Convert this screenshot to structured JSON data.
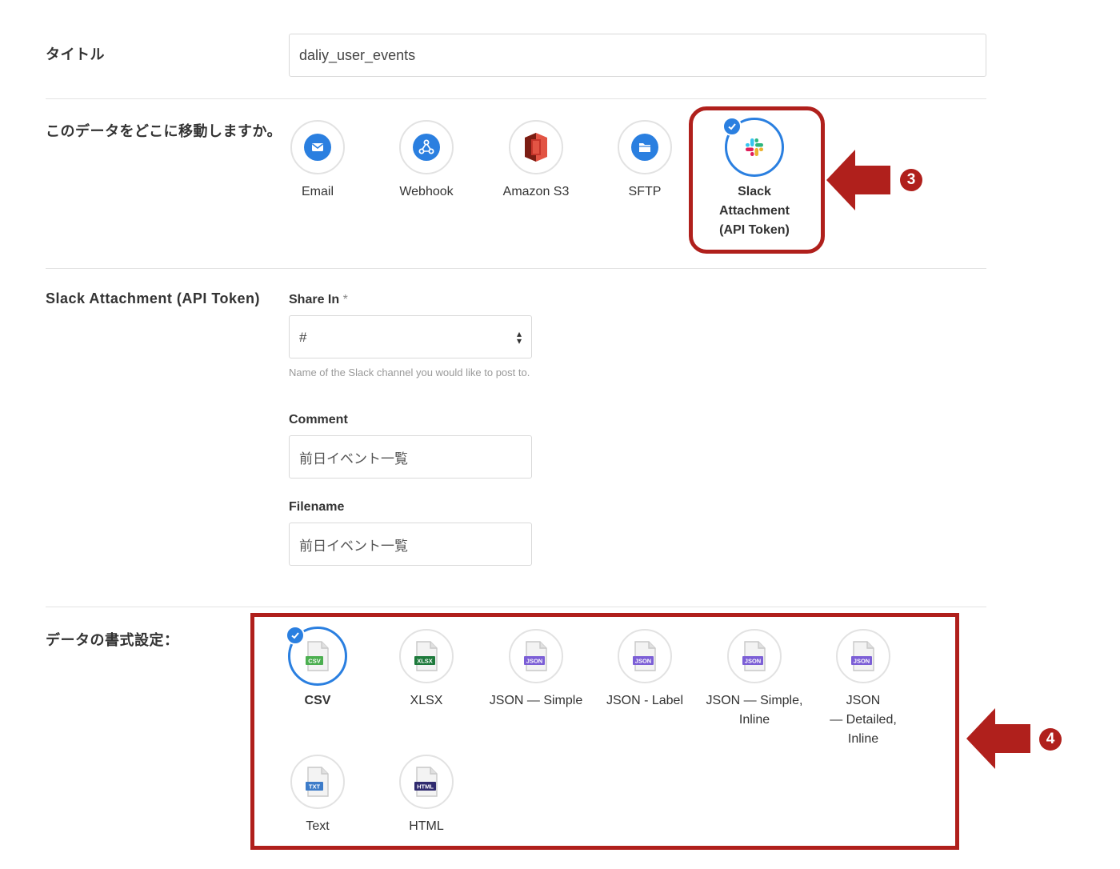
{
  "title_row": {
    "label": "タイトル",
    "value": "daliy_user_events"
  },
  "destination_row": {
    "label": "このデータをどこに移動しますか。",
    "options": [
      {
        "label": "Email",
        "icon": "email-icon",
        "color": "#2a7fe0"
      },
      {
        "label": "Webhook",
        "icon": "webhook-icon",
        "color": "#2a7fe0"
      },
      {
        "label": "Amazon S3",
        "icon": "amazon-s3-icon",
        "color": "#c7352b"
      },
      {
        "label": "SFTP",
        "icon": "folder-icon",
        "color": "#2a7fe0"
      },
      {
        "label_lines": [
          "Slack",
          "Attachment",
          "(API Token)"
        ],
        "icon": "slack-icon",
        "selected": true
      }
    ]
  },
  "slack_section": {
    "label": "Slack Attachment (API Token)",
    "share_in": {
      "label": "Share In",
      "required_mark": "*",
      "value": "#",
      "help": "Name of the Slack channel you would like to post to."
    },
    "comment": {
      "label": "Comment",
      "value": "前日イベント一覧"
    },
    "filename": {
      "label": "Filename",
      "value": "前日イベント一覧"
    }
  },
  "format_row": {
    "label": "データの書式設定：",
    "options": [
      {
        "label": "CSV",
        "badge": "CSV",
        "badge_color": "#4caf50",
        "selected": true
      },
      {
        "label": "XLSX",
        "badge": "XLSX",
        "badge_color": "#1e7a3c"
      },
      {
        "label": "JSON — Simple",
        "badge": "JSON",
        "badge_color": "#7c5fd6"
      },
      {
        "label": "JSON - Label",
        "badge": "JSON",
        "badge_color": "#7c5fd6"
      },
      {
        "label_lines": [
          "JSON — Simple,",
          "Inline"
        ],
        "badge": "JSON",
        "badge_color": "#7c5fd6"
      },
      {
        "label_lines": [
          "JSON",
          "— Detailed,",
          "Inline"
        ],
        "badge": "JSON",
        "badge_color": "#7c5fd6"
      },
      {
        "label": "Text",
        "badge": "TXT",
        "badge_color": "#3d7cc9"
      },
      {
        "label": "HTML",
        "badge": "HTML",
        "badge_color": "#2f2a6e"
      }
    ]
  },
  "annotations": {
    "step3": "3",
    "step4": "4",
    "color": "#b0201c"
  },
  "accent_color": "#2a7fe0"
}
